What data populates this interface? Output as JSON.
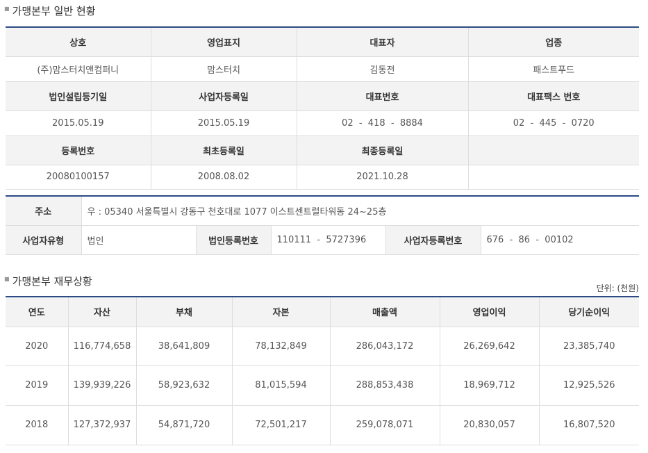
{
  "section1": {
    "title": "가맹본부 일반 현황",
    "headers1": [
      "상호",
      "영업표지",
      "대표자",
      "업종"
    ],
    "row1": [
      "(주)맘스터치앤컴퍼니",
      "맘스터치",
      "김동전",
      "패스트푸드"
    ],
    "headers2": [
      "법인설립등기일",
      "사업자등록일",
      "대표번호",
      "대표팩스 번호"
    ],
    "row2": [
      "2015.05.19",
      "2015.05.19",
      "02  -  418  -  8884",
      "02  -  445  -  0720"
    ],
    "headers3": [
      "등록번호",
      "최초등록일",
      "최종등록일",
      ""
    ],
    "row3": [
      "20080100157",
      "2008.08.02",
      "2021.10.28",
      ""
    ]
  },
  "address": {
    "label": "주소",
    "value": "우 : 05340 서울특별시 강동구 천호대로 1077 이스트센트럴타워동 24~25층",
    "biz_type_label": "사업자유형",
    "biz_type_value": "법인",
    "corp_no_label": "법인등록번호",
    "corp_no_value": "110111  -  5727396",
    "biz_no_label": "사업자등록번호",
    "biz_no_value": "676  -  86  -  00102"
  },
  "section2": {
    "title": "가맹본부 재무상황",
    "unit": "단위: (천원)",
    "headers": [
      "연도",
      "자산",
      "부채",
      "자본",
      "매출액",
      "영업이익",
      "당기순이익"
    ],
    "rows": [
      [
        "2020",
        "116,774,658",
        "38,641,809",
        "78,132,849",
        "286,043,172",
        "26,269,642",
        "23,385,740"
      ],
      [
        "2019",
        "139,939,226",
        "58,923,632",
        "81,015,594",
        "288,853,438",
        "18,969,712",
        "12,925,526"
      ],
      [
        "2018",
        "127,372,937",
        "54,871,720",
        "72,501,217",
        "259,078,071",
        "20,830,057",
        "16,807,520"
      ]
    ]
  }
}
